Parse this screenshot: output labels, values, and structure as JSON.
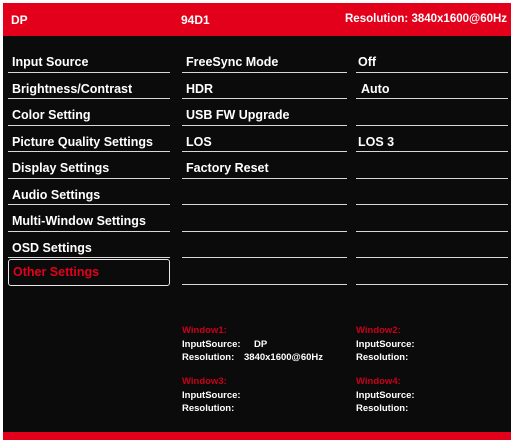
{
  "header": {
    "input": "DP",
    "model": "94D1",
    "resolution": "Resolution: 3840x1600@60Hz"
  },
  "menu": {
    "items": [
      {
        "label": "Input Source"
      },
      {
        "label": "Brightness/Contrast"
      },
      {
        "label": "Color Setting"
      },
      {
        "label": "Picture Quality Settings"
      },
      {
        "label": "Display Settings"
      },
      {
        "label": "Audio Settings"
      },
      {
        "label": "Multi-Window Settings"
      },
      {
        "label": "OSD Settings"
      },
      {
        "label": "Other Settings",
        "selected": true
      }
    ]
  },
  "submenu": {
    "items": [
      {
        "label": "FreeSync Mode",
        "value": "Off"
      },
      {
        "label": "HDR",
        "value": "Auto"
      },
      {
        "label": "USB FW Upgrade",
        "value": ""
      },
      {
        "label": "LOS",
        "value": "LOS 3"
      },
      {
        "label": "Factory Reset",
        "value": ""
      },
      {
        "label": "",
        "value": ""
      },
      {
        "label": "",
        "value": ""
      },
      {
        "label": "",
        "value": ""
      },
      {
        "label": "",
        "value": ""
      }
    ]
  },
  "windows": {
    "w1": {
      "title": "Window1:",
      "input_label": "InputSource:",
      "input_value": "DP",
      "res_label": "Resolution:",
      "res_value": "3840x1600@60Hz"
    },
    "w2": {
      "title": "Window2:",
      "input_label": "InputSource:",
      "input_value": "",
      "res_label": "Resolution:",
      "res_value": ""
    },
    "w3": {
      "title": "Window3:",
      "input_label": "InputSource:",
      "input_value": "",
      "res_label": "Resolution:",
      "res_value": ""
    },
    "w4": {
      "title": "Window4:",
      "input_label": "InputSource:",
      "input_value": "",
      "res_label": "Resolution:",
      "res_value": ""
    }
  },
  "colors": {
    "accent": "#e3001b",
    "background": "#0b0b0b",
    "text": "#ffffff"
  }
}
